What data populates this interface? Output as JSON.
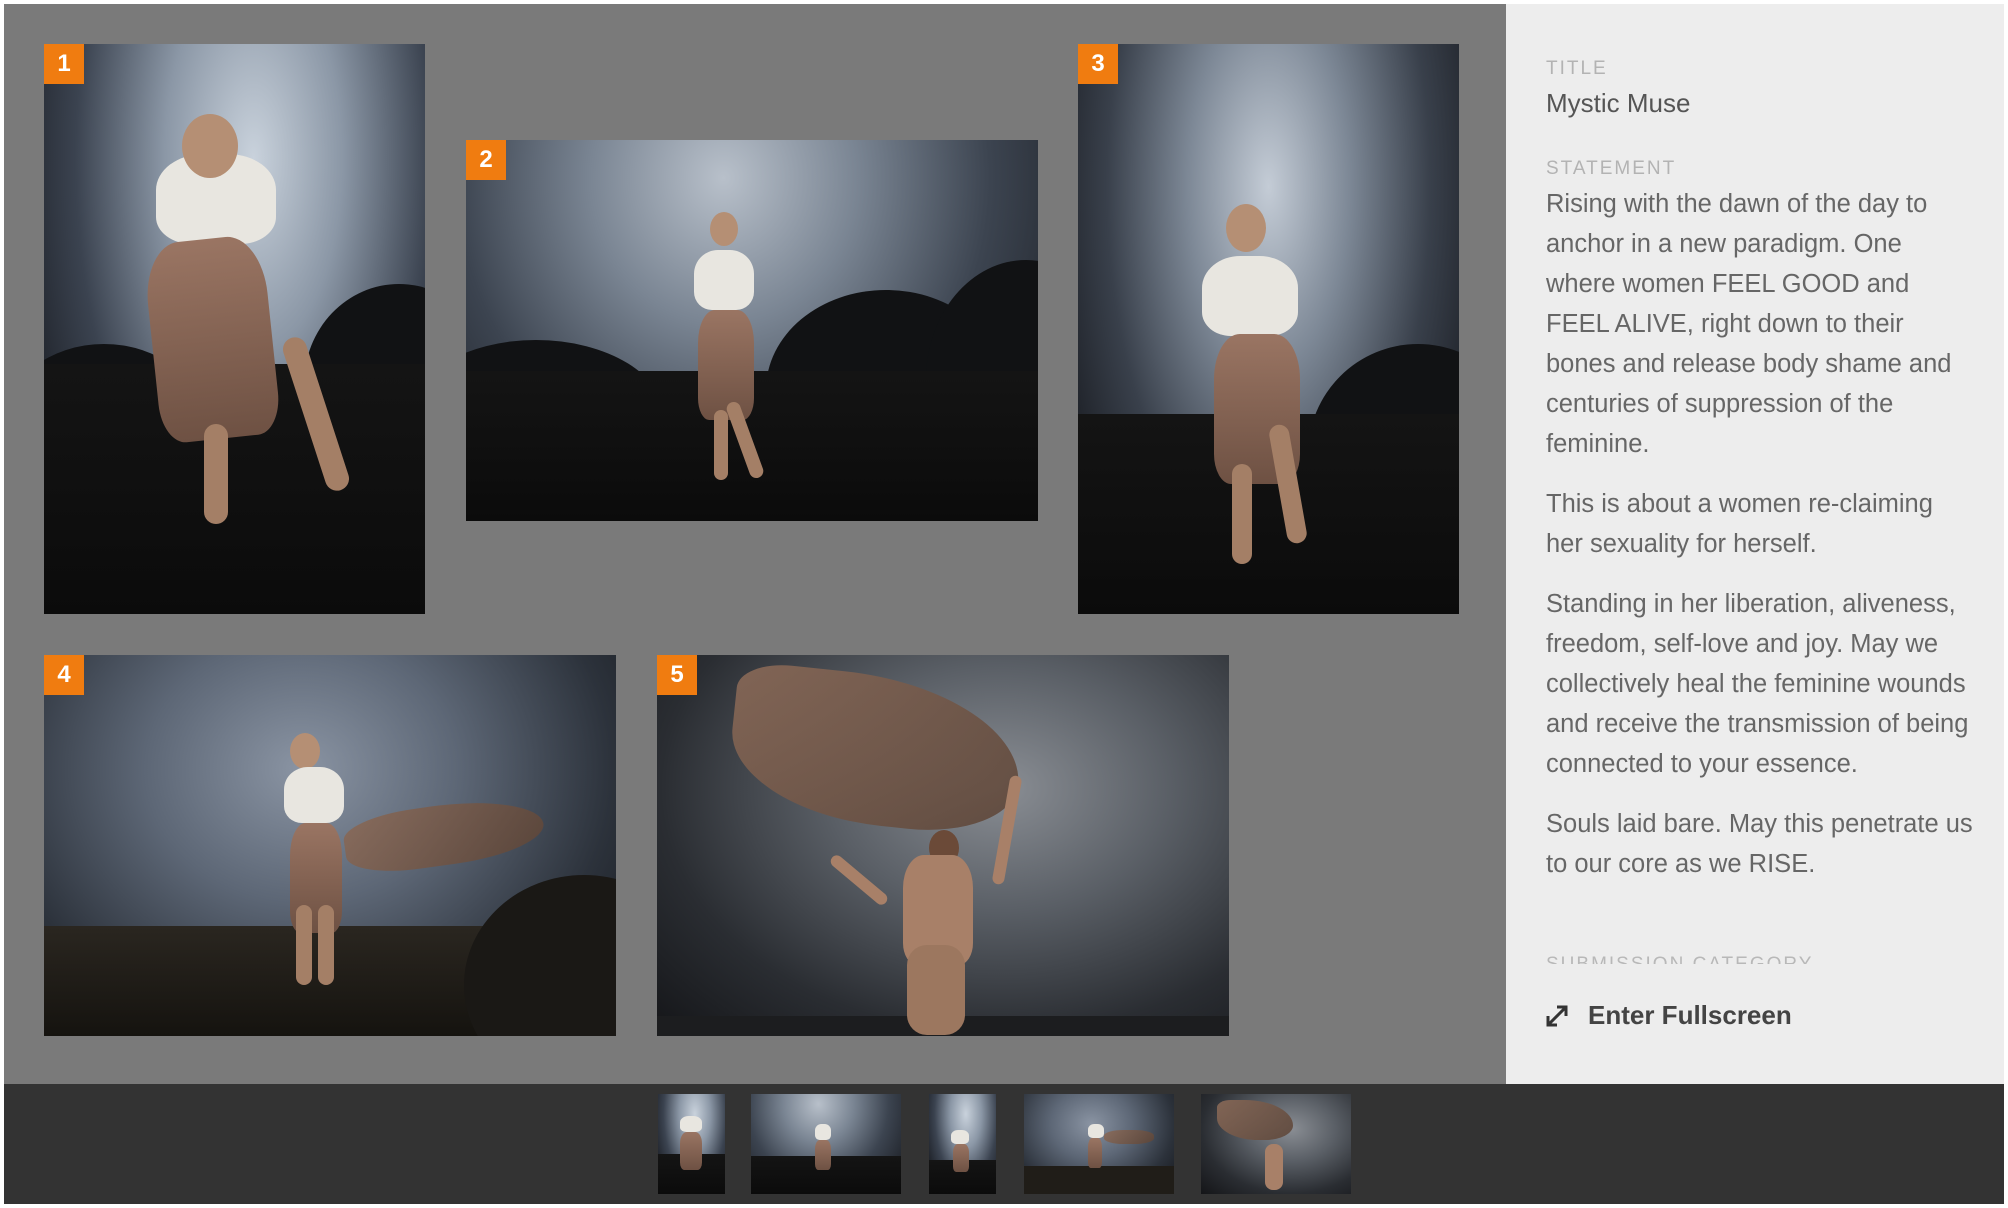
{
  "gallery": {
    "photos": [
      {
        "number": "1",
        "alt": "woman in white top and brown wrap skirt, arm over head, looking up, dark trees behind"
      },
      {
        "number": "2",
        "alt": "woman standing on hill against pale sky with dark treeline"
      },
      {
        "number": "3",
        "alt": "woman in white top standing, looking to the side, dark sky"
      },
      {
        "number": "4",
        "alt": "woman arching back with flowing brown fabric in grassland"
      },
      {
        "number": "5",
        "alt": "nude figure from behind holding billowing brown fabric overhead"
      }
    ]
  },
  "panel": {
    "title_label": "TITLE",
    "title_value": "Mystic Muse",
    "statement_label": "STATEMENT",
    "statement": [
      "Rising with the dawn of the day to anchor in a new paradigm. One where women FEEL GOOD and FEEL ALIVE, right down to their bones and release body shame and centuries of suppression of the feminine.",
      "This is about a women re-claiming her sexuality for herself.",
      "Standing in her liberation, aliveness, freedom, self-love and joy. May we collectively heal the feminine wounds and receive the transmission of being connected to your essence.",
      "Souls laid bare. May this penetrate us to our core as we RISE."
    ],
    "next_label": "SUBMISSION CATEGORY",
    "fullscreen_label": "Enter Fullscreen",
    "fullscreen_icon": "expand-diagonal-icon"
  },
  "colors": {
    "badge": "#f07c10",
    "gallery_bg": "#7a7a7a",
    "panel_bg": "#ededed",
    "filmstrip_bg": "#333333"
  }
}
